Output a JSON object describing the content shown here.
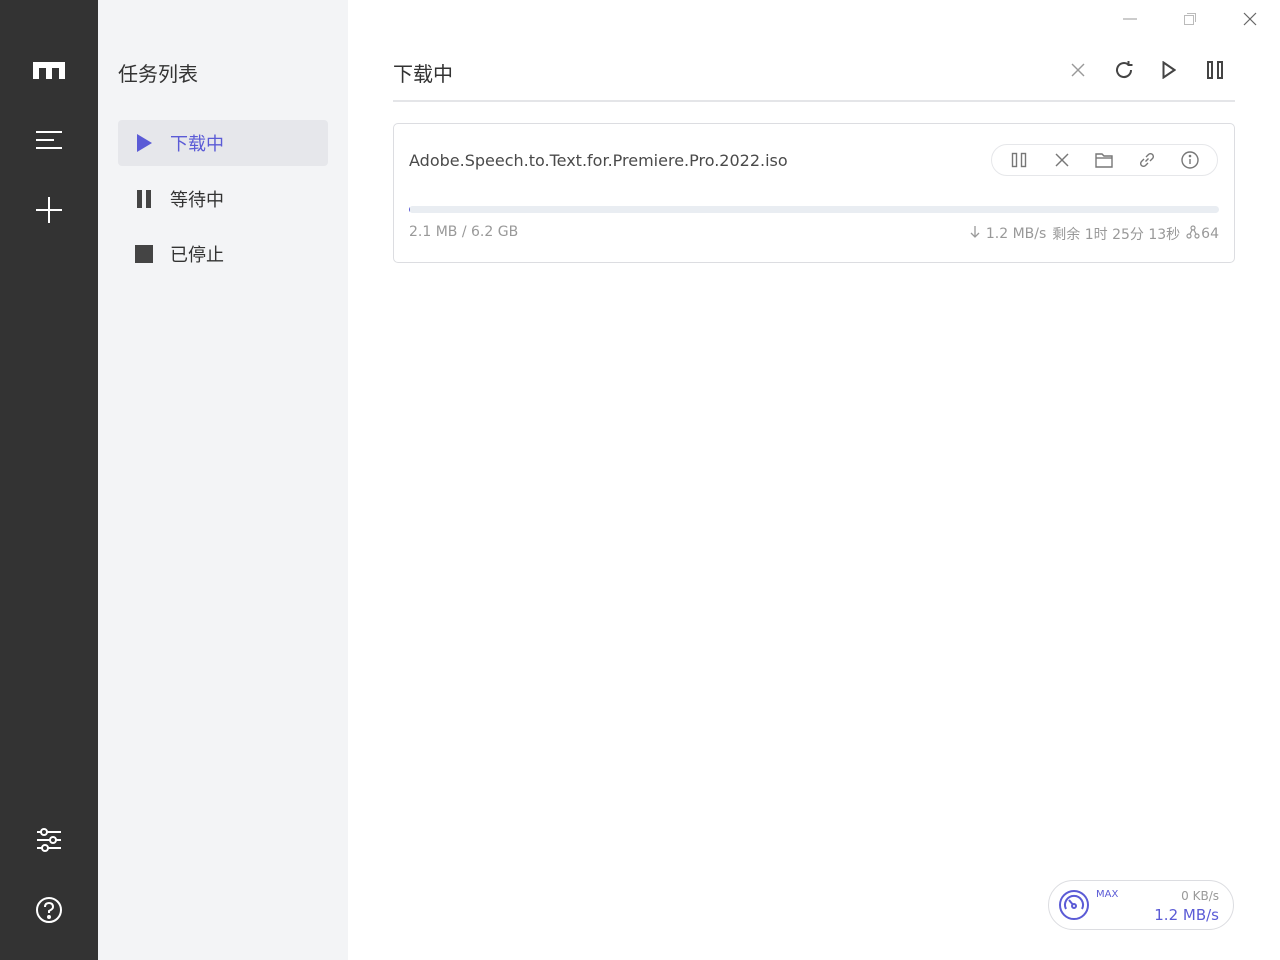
{
  "app": {
    "title": "Motrix",
    "accent_color": "#5b5bd6"
  },
  "rail": {
    "items": [
      {
        "name": "logo-icon",
        "icon": "motrix-m-icon"
      },
      {
        "name": "menu-icon",
        "icon": "hamburger-icon"
      },
      {
        "name": "add-task-icon",
        "icon": "plus-icon"
      },
      {
        "name": "preferences-icon",
        "icon": "sliders-icon"
      },
      {
        "name": "help-icon",
        "icon": "question-circle-icon"
      }
    ]
  },
  "subnav": {
    "title": "任务列表",
    "items": [
      {
        "label": "下载中",
        "icon": "play-icon",
        "active": true
      },
      {
        "label": "等待中",
        "icon": "pause-icon",
        "active": false
      },
      {
        "label": "已停止",
        "icon": "stop-icon",
        "active": false
      }
    ]
  },
  "window_controls": {
    "minimize": "minimize-icon",
    "maximize": "maximize-icon",
    "close": "close-icon"
  },
  "main": {
    "title": "下载中",
    "toolbar": [
      "clear-icon",
      "refresh-icon",
      "resume-all-icon",
      "pause-all-icon"
    ]
  },
  "tasks": [
    {
      "name": "Adobe.Speech.to.Text.for.Premiere.Pro.2022.iso",
      "size": "2.1 MB / 6.2 GB",
      "progress": 0.0003,
      "speed": "1.2 MB/s",
      "remaining": "剩余 1时 25分 13秒",
      "connections": "64",
      "actions": [
        "pause-icon",
        "delete-icon",
        "folder-icon",
        "link-icon",
        "info-icon"
      ]
    }
  ],
  "speed_meter": {
    "label": "MAX",
    "upload": "0 KB/s",
    "download": "1.2 MB/s"
  }
}
